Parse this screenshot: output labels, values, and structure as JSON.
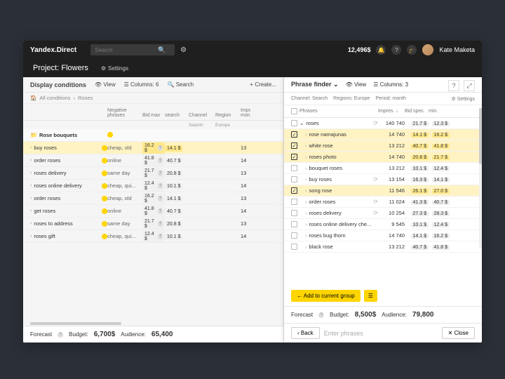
{
  "topbar": {
    "logo": "Yandex.Direct",
    "search_placeholder": "Search",
    "balance": "12,496$",
    "username": "Kate Maketa"
  },
  "project": {
    "title": "Project: Flowers",
    "settings": "Settings"
  },
  "left": {
    "toolbar": {
      "title": "Display conditions",
      "view": "View",
      "columns": "Columns: 6",
      "search": "Search",
      "create": "+ Create..."
    },
    "breadcrumb": {
      "a": "All conditions",
      "b": "Roses"
    },
    "headers": {
      "name": "",
      "neg": "Negative phrases",
      "bid": "Bid max",
      "search": "search",
      "channel": "Channel",
      "region": "Region",
      "impr": "Impr. mon"
    },
    "subheaders": {
      "channel": "Search",
      "region": "Europe"
    },
    "group": "Rose bouquets",
    "rows": [
      {
        "name": "buy roses",
        "neg": "cheap, old",
        "bid": "16.2 $",
        "search": "14.1 $",
        "impr": "13"
      },
      {
        "name": "order roses",
        "neg": "online",
        "bid": "41.8 $",
        "search": "40.7 $",
        "impr": "14"
      },
      {
        "name": "roses delivery",
        "neg": "same day",
        "bid": "21.7 $",
        "search": "20.8 $",
        "impr": "13"
      },
      {
        "name": "roses online delivery",
        "neg": "cheap, qui...",
        "bid": "12.4 $",
        "search": "10.1 $",
        "impr": "14"
      },
      {
        "name": "order roses",
        "neg": "cheap, old",
        "bid": "16.2 $",
        "search": "14.1 $",
        "impr": "13"
      },
      {
        "name": "get roses",
        "neg": "online",
        "bid": "41.8 $",
        "search": "40.7 $",
        "impr": "14"
      },
      {
        "name": "roses to address",
        "neg": "same day",
        "bid": "21.7 $",
        "search": "20.8 $",
        "impr": "13"
      },
      {
        "name": "roses gift",
        "neg": "cheap, qui...",
        "bid": "12.4 $",
        "search": "10.1 $",
        "impr": "14"
      }
    ],
    "forecast": {
      "label": "Forecast",
      "budget_label": "Budget:",
      "budget": "6,700$",
      "audience_label": "Audience:",
      "audience": "65,400"
    }
  },
  "right": {
    "toolbar": {
      "title": "Phrase finder",
      "view": "View",
      "columns": "Columns: 3"
    },
    "filter": {
      "channel": "Channel: Search",
      "regions": "Regions: Europe",
      "period": "Period: month",
      "settings": "Settings"
    },
    "headers": {
      "phrases": "Phrases",
      "impr": "Impres.",
      "bid": "Bid spec.",
      "min": "min."
    },
    "parent": {
      "name": "roses",
      "impr": "140 740",
      "bid": "21.7 $",
      "min": "12.3 $"
    },
    "rows": [
      {
        "chk": true,
        "name": "rose namajunas",
        "impr": "14 740",
        "bid": "14.1 $",
        "min": "16.2 $",
        "hl": true
      },
      {
        "chk": true,
        "name": "white rose",
        "impr": "13 212",
        "bid": "40.7 $",
        "min": "41.8 $",
        "hl": true
      },
      {
        "chk": true,
        "name": "roses photo",
        "impr": "14 740",
        "bid": "20.8 $",
        "min": "21.7 $",
        "hl": true
      },
      {
        "chk": false,
        "name": "bouquet roses",
        "impr": "13 212",
        "bid": "10.1 $",
        "min": "12.4 $",
        "hl": false
      },
      {
        "chk": false,
        "name": "buy roses",
        "impr": "13 154",
        "bid": "16.3 $",
        "min": "14.1 $",
        "hl": false,
        "sync": true
      },
      {
        "chk": true,
        "name": "song rose",
        "impr": "11 546",
        "bid": "26.1 $",
        "min": "27.0 $",
        "hl": true
      },
      {
        "chk": false,
        "name": "order roses",
        "impr": "11 024",
        "bid": "41.3 $",
        "min": "40.7 $",
        "hl": false,
        "sync": true
      },
      {
        "chk": false,
        "name": "roses delivery",
        "impr": "10 254",
        "bid": "27.3 $",
        "min": "28.3 $",
        "hl": false,
        "sync": true
      },
      {
        "chk": false,
        "name": "roses online delivery che...",
        "impr": "9 545",
        "bid": "10.1 $",
        "min": "12.4 $",
        "hl": false
      },
      {
        "chk": false,
        "name": "roses bug thorn",
        "impr": "14 740",
        "bid": "14.1 $",
        "min": "16.2 $",
        "hl": false
      },
      {
        "chk": false,
        "name": "black rose",
        "impr": "13 212",
        "bid": "40.7 $",
        "min": "41.8 $",
        "hl": false
      }
    ],
    "add": "Add to current group",
    "forecast": {
      "label": "Forecast",
      "budget_label": "Budget:",
      "budget": "8,500$",
      "audience_label": "Audience:",
      "audience": "79,800"
    },
    "footer": {
      "back": "Back",
      "enter": "Enter phrases",
      "close": "Close"
    }
  }
}
